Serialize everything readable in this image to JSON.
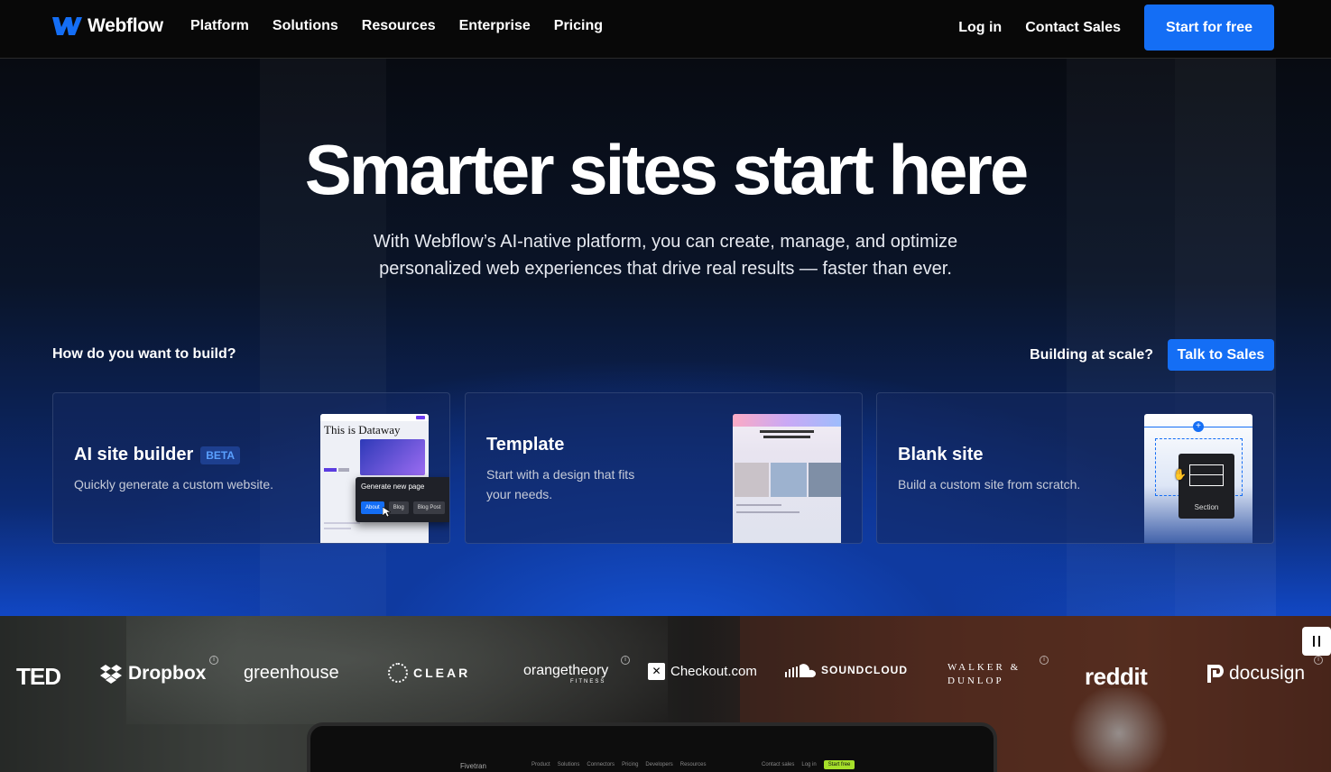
{
  "nav": {
    "logo_text": "Webflow",
    "links": [
      "Platform",
      "Solutions",
      "Resources",
      "Enterprise",
      "Pricing"
    ],
    "login": "Log in",
    "contact": "Contact Sales",
    "cta": "Start for free"
  },
  "hero": {
    "title": "Smarter sites start here",
    "subtitle_line1": "With Webflow’s AI-native platform, you can create, manage, and optimize",
    "subtitle_line2": "personalized web experiences that drive real results — faster than ever.",
    "build_question": "How do you want to build?",
    "scale_text": "Building at scale?",
    "sales_button": "Talk to Sales"
  },
  "cards": [
    {
      "title": "AI site builder",
      "badge": "BETA",
      "desc": "Quickly generate a custom website.",
      "preview": {
        "headline": "This is Dataway",
        "popup_title": "Generate new page",
        "chips": [
          "About",
          "Blog",
          "Blog Post"
        ]
      }
    },
    {
      "title": "Template",
      "desc_line1": "Start with a design that fits",
      "desc_line2": "your needs."
    },
    {
      "title": "Blank site",
      "desc": "Build a custom site from scratch.",
      "preview": {
        "section_label": "Section"
      }
    }
  ],
  "logos": [
    "TED",
    "Dropbox",
    "greenhouse",
    "CLEAR",
    "orangetheory",
    "Checkout.com",
    "SOUNDCLOUD",
    "WALKER & DUNLOP",
    "reddit",
    "docusign"
  ],
  "logo_sub": {
    "orangetheory": "FITNESS"
  },
  "video": {
    "brand": "Fivetran",
    "nav": [
      "Product",
      "Solutions",
      "Connectors",
      "Pricing",
      "Developers",
      "Resources"
    ],
    "contact": "Contact sales",
    "login": "Log in",
    "cta": "Start free"
  },
  "colors": {
    "accent": "#146ef5",
    "background": "#080808",
    "badge_text": "#5aa0ff"
  }
}
